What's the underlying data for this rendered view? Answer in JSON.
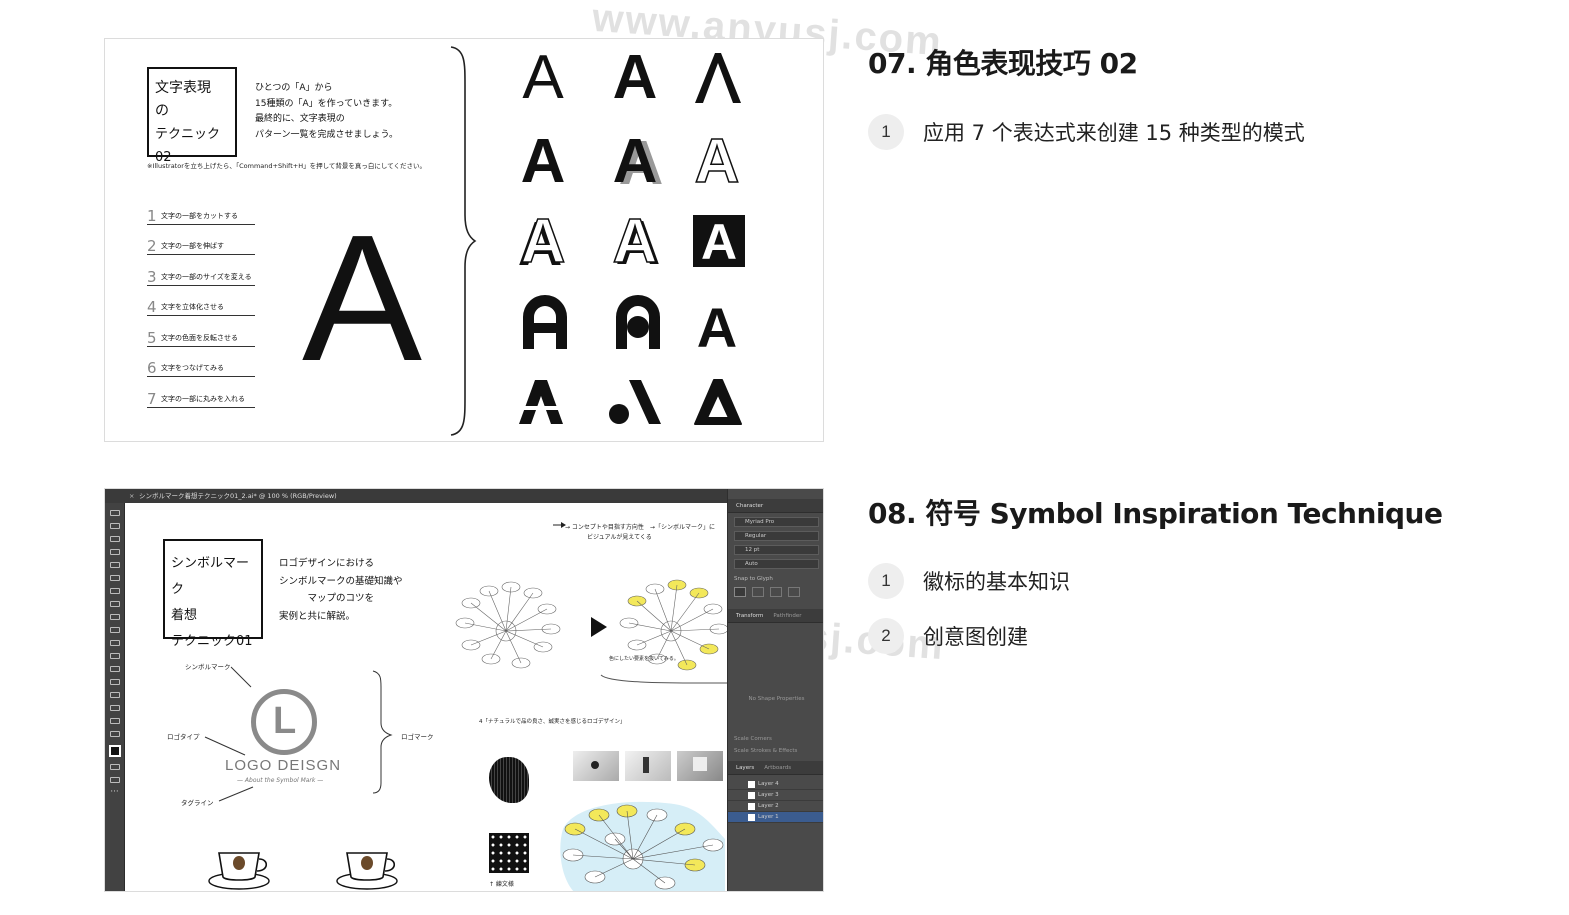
{
  "watermark": "www.anyusj.com",
  "sections": [
    {
      "heading": "07. 角色表现技巧 02",
      "items": [
        {
          "num": "1",
          "label": "应用 7 个表达式来创建 15 种类型的模式"
        }
      ]
    },
    {
      "heading": "08. 符号 Symbol Inspiration Technique",
      "items": [
        {
          "num": "1",
          "label": "徽标的基本知识"
        },
        {
          "num": "2",
          "label": "创意图创建"
        }
      ]
    }
  ],
  "card1": {
    "title_lines": [
      "文字表現",
      "の",
      "テクニック02"
    ],
    "desc_lines": [
      "ひとつの「A」から",
      "15種類の「A」を作っていきます。",
      "最終的に、文字表現の",
      "パターン一覧を完成させましょう。"
    ],
    "note": "※Illustratorを立ち上げたら、「Command+Shift+H」を押して背景を真っ白にしてください。",
    "list": [
      {
        "num": "1",
        "text": "文字の一部をカットする"
      },
      {
        "num": "2",
        "text": "文字の一部を伸ばす"
      },
      {
        "num": "3",
        "text": "文字の一部のサイズを変える"
      },
      {
        "num": "4",
        "text": "文字を立体化させる"
      },
      {
        "num": "5",
        "text": "文字の色面を反転させる"
      },
      {
        "num": "6",
        "text": "文字をつなげてみる"
      },
      {
        "num": "7",
        "text": "文字の一部に丸みを入れる"
      }
    ],
    "big_letter": "A",
    "grid_letter": "A"
  },
  "card2": {
    "window_title": "シンボルマーク着想テクニック01_2.ai* @ 100 % (RGB/Preview)",
    "title_lines": [
      "シンボルマーク",
      "着想",
      "テクニック01"
    ],
    "desc_lines": [
      "ロゴデザインにおける",
      "シンボルマークの基礎知識や",
      "　　　マップのコツを",
      "実例と共に解説。"
    ],
    "label_symbol": "シンボルマーク",
    "label_logotype": "ロゴタイプ",
    "label_tagline": "タグライン",
    "label_logomark": "ロゴマーク",
    "logo_letter": "L",
    "logo_text": "LOGO DEISGN",
    "logo_sub": "— About the Symbol Mark —",
    "arrow_note_1": "→ コンセプトや目指す方向性　→「シンボルマーク」に",
    "arrow_note_2": "ビジュアルが見えてくる",
    "mindmap_note": "色にしたい要素を抜いてみる。",
    "section_note": "4「ナチュラルで品の良さ、誠実さを感じるロゴデザイン」",
    "pattern_caption": "↑ 練文様",
    "panel": {
      "tab_character": "Character",
      "font_name": "Myriad Pro",
      "font_style": "Regular",
      "font_size": "12 pt",
      "leading": "Auto",
      "snap_label": "Snap to Glyph",
      "tab_transform": "Transform",
      "tab_pathfinder": "Pathfinder",
      "no_shape": "No Shape Properties",
      "scale_corners": "Scale Corners",
      "scale_strokes": "Scale Strokes & Effects",
      "tab_layers": "Layers",
      "tab_artboards": "Artboards",
      "layers": [
        "Layer 4",
        "Layer 3",
        "Layer 2",
        "Layer 1"
      ]
    }
  }
}
